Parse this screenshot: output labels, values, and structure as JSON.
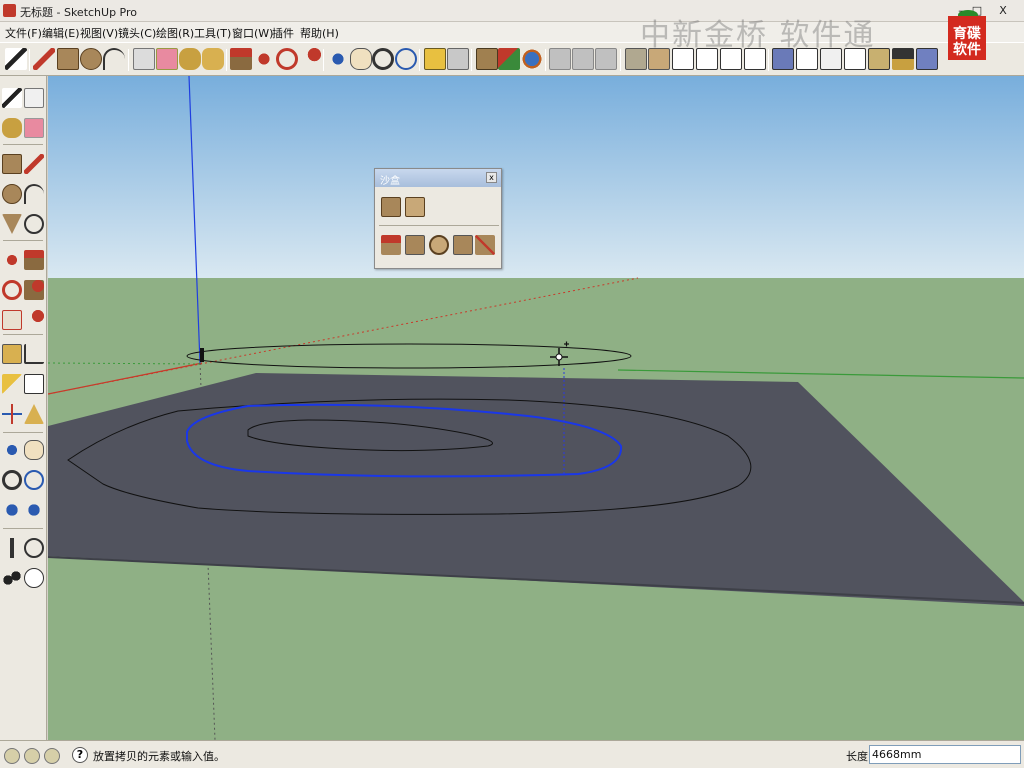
{
  "window": {
    "title": "无标题 - SketchUp Pro",
    "minimize": "–",
    "restore": "□",
    "close": "X"
  },
  "menu": [
    "文件(F)",
    "编辑(E)",
    "视图(V)",
    "镜头(C)",
    "绘图(R)",
    "工具(T)",
    "窗口(W)",
    "插件",
    "帮助(H)"
  ],
  "watermark": "中新金桥 软件通",
  "logo": {
    "line1": "育碟",
    "line2": "软件"
  },
  "toolbar": {
    "icons": [
      "select-icon",
      "pencil-icon",
      "rectangle-icon",
      "circle-icon",
      "arc-icon",
      "eraser-icon",
      "eraser-pink-icon",
      "paint-bucket-icon",
      "paint-icon",
      "push-pull-icon",
      "move-icon",
      "rotate-icon",
      "follow-me-icon",
      "orbit-icon",
      "pan-icon",
      "zoom-icon",
      "zoom-extents-icon",
      "prev-view-icon",
      "next-view-icon",
      "get-models-icon",
      "share-model-icon",
      "google-earth-icon",
      "component-icon",
      "component2-icon",
      "component3-icon",
      "iso-view-icon",
      "top-view-icon",
      "front-view-icon",
      "right-view-icon",
      "back-view-icon",
      "left-view-icon",
      "xray-icon",
      "wireframe-icon",
      "hidden-line-icon",
      "shaded-icon",
      "shaded-texture-icon",
      "monochrome-icon"
    ]
  },
  "left_toolbar": {
    "icons": [
      "select-icon",
      "make-component-icon",
      "paint-bucket-icon",
      "eraser-icon",
      "rectangle-icon",
      "line-icon",
      "circle-icon",
      "arc-icon",
      "polygon-icon",
      "freehand-icon",
      "move-icon",
      "push-pull-icon",
      "rotate-icon",
      "follow-me-icon",
      "scale-icon",
      "offset-icon",
      "tape-measure-icon",
      "dimension-icon",
      "protractor-icon",
      "text-icon",
      "axes-icon",
      "3d-text-icon",
      "orbit-icon",
      "pan-icon",
      "zoom-icon",
      "zoom-window-icon",
      "zoom-extents-icon",
      "previous-icon",
      "position-camera-icon",
      "look-around-icon",
      "walk-icon",
      "section-plane-icon"
    ]
  },
  "inspector": {
    "title": "沙盒",
    "close": "x",
    "icons": [
      "from-contours-icon",
      "from-scratch-icon",
      "smoove-icon",
      "stamp-icon",
      "drape-icon",
      "add-detail-icon",
      "flip-edge-icon"
    ]
  },
  "status": {
    "message": "放置拷贝的元素或输入值。",
    "vcb_label": "长度",
    "vcb_value": "4668mm"
  },
  "colors": {
    "sky_top": "#78aedc",
    "sky_bottom": "#d9e8f1",
    "ground": "#8fb085",
    "terrain": "#51535e",
    "axis_blue": "#1f3ee0",
    "axis_red": "#c83a2a",
    "axis_green": "#3a9a3a",
    "selected_contour": "#1a37e8"
  }
}
